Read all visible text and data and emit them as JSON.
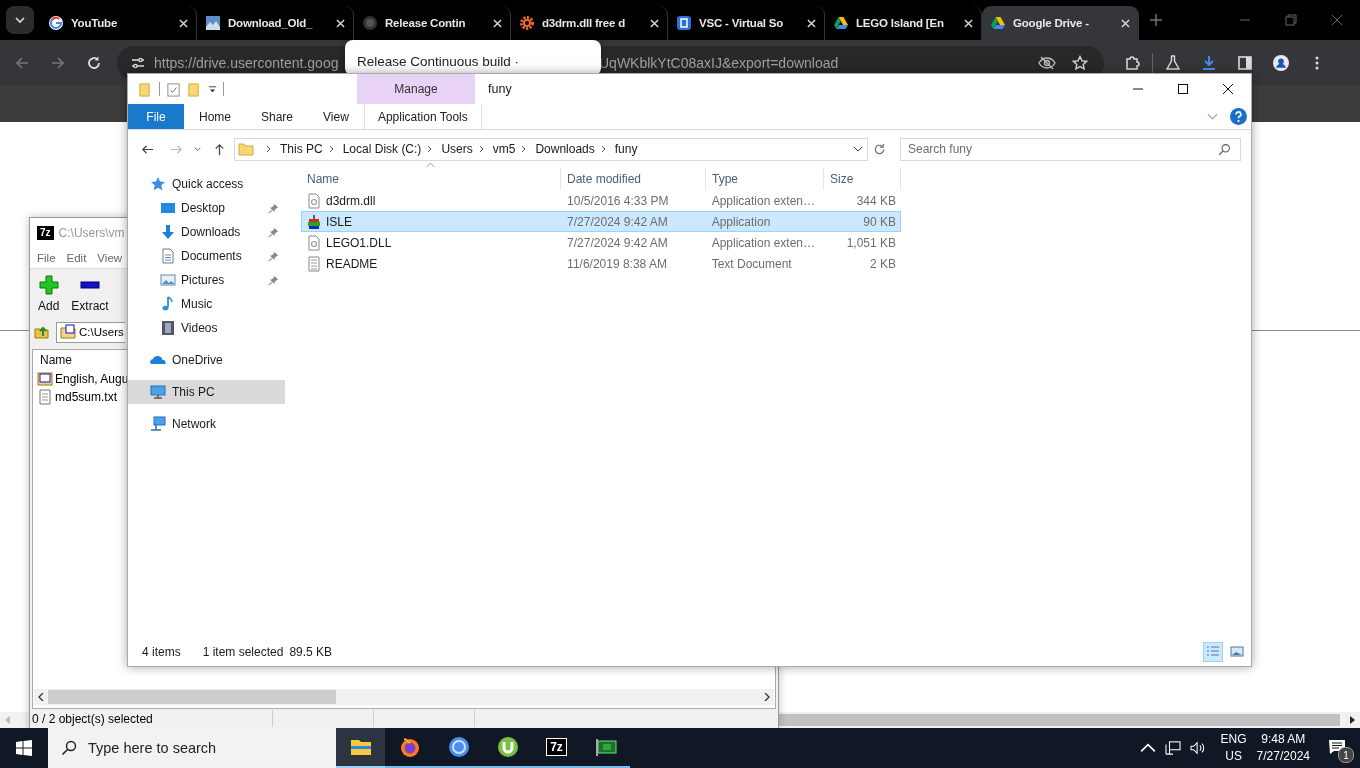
{
  "browser": {
    "tabs": [
      {
        "kind": "google",
        "title": "YouTube",
        "selected": false
      },
      {
        "kind": "image",
        "title": "Download_Old_",
        "selected": false
      },
      {
        "kind": "github",
        "title": "Release Contin",
        "selected": false
      },
      {
        "kind": "gear",
        "title": "d3drm.dll free d",
        "selected": false
      },
      {
        "kind": "square",
        "title": "VSC - Virtual So",
        "selected": false
      },
      {
        "kind": "drive",
        "title": "LEGO Island [En",
        "selected": false
      },
      {
        "kind": "drive",
        "title": "Google Drive - ",
        "selected": true
      }
    ],
    "url": [
      "https://drive.usercontent.goog",
      "UqWKblkYtC08axIJ&export=download"
    ],
    "tooltip": "Release Continuous build ·"
  },
  "sevenzip": {
    "title": "C:\\Users\\vm",
    "icon_text": "7z",
    "menu": [
      "File",
      "Edit",
      "View"
    ],
    "tools": [
      {
        "kind": "add",
        "label": "Add"
      },
      {
        "kind": "extract",
        "label": "Extract"
      }
    ],
    "path": "C:\\Users",
    "column": "Name",
    "rows": [
      {
        "kind": "iso",
        "name": "English, Augu"
      },
      {
        "kind": "text",
        "name": "md5sum.txt"
      }
    ],
    "status": "0 / 2 object(s) selected"
  },
  "explorer": {
    "title": "funy",
    "context_header": "Manage",
    "ribbon_tabs": [
      {
        "kind": "file",
        "label": "File"
      },
      {
        "kind": "tab",
        "label": "Home"
      },
      {
        "kind": "tab",
        "label": "Share"
      },
      {
        "kind": "tab",
        "label": "View"
      },
      {
        "kind": "context",
        "label": "Application Tools"
      }
    ],
    "breadcrumb": [
      "This PC",
      "Local Disk (C:)",
      "Users",
      "vm5",
      "Downloads",
      "funy"
    ],
    "search_placeholder": "Search funy",
    "nav": [
      {
        "kind": "quick",
        "label": "Quick access",
        "selected": false,
        "children": [
          {
            "kind": "desktop",
            "label": "Desktop",
            "pinned": true,
            "selected": false
          },
          {
            "kind": "downloads",
            "label": "Downloads",
            "pinned": true,
            "selected": false
          },
          {
            "kind": "documents",
            "label": "Documents",
            "pinned": true,
            "selected": false
          },
          {
            "kind": "pictures",
            "label": "Pictures",
            "pinned": true,
            "selected": false
          },
          {
            "kind": "music",
            "label": "Music",
            "pinned": false,
            "selected": false
          },
          {
            "kind": "videos",
            "label": "Videos",
            "pinned": false,
            "selected": false
          }
        ]
      },
      {
        "kind": "onedrive",
        "label": "OneDrive",
        "selected": false
      },
      {
        "kind": "pc",
        "label": "This PC",
        "selected": true
      },
      {
        "kind": "network",
        "label": "Network",
        "selected": false
      }
    ],
    "columns": [
      "Name",
      "Date modified",
      "Type",
      "Size"
    ],
    "files": [
      {
        "kind": "dll",
        "name": "d3drm.dll",
        "date": "10/5/2016 4:33 PM",
        "type": "Application exten…",
        "size": "344 KB",
        "selected": false
      },
      {
        "kind": "app",
        "name": "ISLE",
        "date": "7/27/2024 9:42 AM",
        "type": "Application",
        "size": "90 KB",
        "selected": true
      },
      {
        "kind": "dll",
        "name": "LEGO1.DLL",
        "date": "7/27/2024 9:42 AM",
        "type": "Application exten…",
        "size": "1,051 KB",
        "selected": false
      },
      {
        "kind": "text",
        "name": "README",
        "date": "11/6/2019 8:38 AM",
        "type": "Text Document",
        "size": "2 KB",
        "selected": false
      }
    ],
    "status": [
      "4 items",
      "1 item selected",
      "89.5 KB"
    ],
    "views": [
      {
        "kind": "details",
        "selected": true
      },
      {
        "kind": "large",
        "selected": false
      }
    ]
  },
  "taskbar": {
    "search_placeholder": "Type here to search",
    "apps": [
      {
        "kind": "explorer",
        "selected": true
      },
      {
        "kind": "firefox",
        "selected": false
      },
      {
        "kind": "chrome",
        "selected": false
      },
      {
        "kind": "utorrent",
        "selected": false
      },
      {
        "kind": "sevenzip",
        "label": "7z",
        "selected": false
      },
      {
        "kind": "gpu",
        "selected": false
      }
    ],
    "lang": [
      "ENG",
      "US"
    ],
    "time": "9:48 AM",
    "date": "7/27/2024",
    "notifications": "1"
  }
}
